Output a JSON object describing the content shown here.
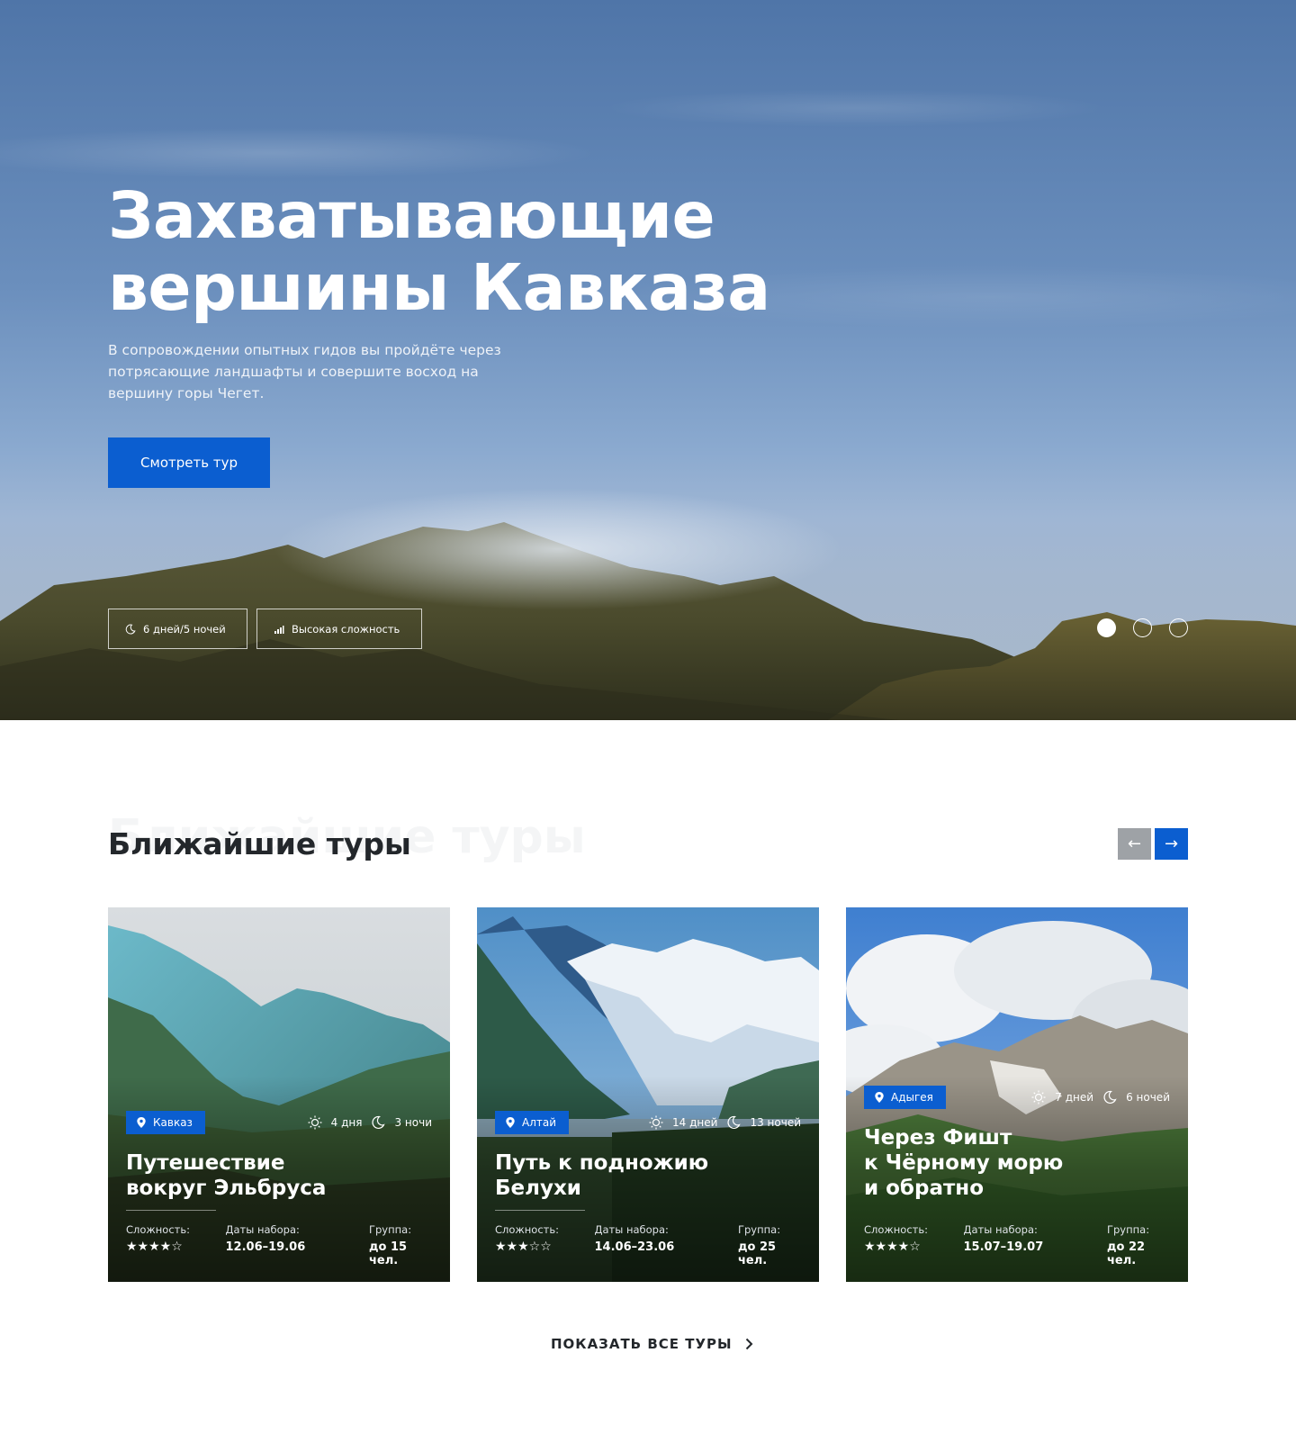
{
  "hero": {
    "title_line1": "Захватывающие",
    "title_line2": "вершины Кавказа",
    "description": "В сопровождении опытных гидов вы пройдёте через потрясающие ландшафты и совершите восход на вершину горы Чегет.",
    "button_label": "Смотреть тур",
    "tag_duration": "6 дней/5 ночей",
    "tag_difficulty": "Высокая сложность",
    "slides": 3,
    "active_slide": 1
  },
  "section": {
    "title": "Ближайшие туры",
    "ghost_title": "Ближайшие туры",
    "prev_label": "←",
    "next_label": "→"
  },
  "labels": {
    "difficulty": "Сложность:",
    "dates": "Даты набора:",
    "group": "Группа:"
  },
  "tours": [
    {
      "region": "Кавказ",
      "days": "4 дня",
      "nights": "3 ночи",
      "title_line1": "Путешествие",
      "title_line2": "вокруг Эльбруса",
      "title_line3": "",
      "difficulty_stars": "★★★★☆",
      "difficulty_rating": 4,
      "dates": "12.06–19.06",
      "group": "до 15 чел."
    },
    {
      "region": "Алтай",
      "days": "14 дней",
      "nights": "13 ночей",
      "title_line1": "Путь к подножию",
      "title_line2": "Белухи",
      "title_line3": "",
      "difficulty_stars": "★★★☆☆",
      "difficulty_rating": 3,
      "dates": "14.06–23.06",
      "group": "до 25 чел."
    },
    {
      "region": "Адыгея",
      "days": "7 дней",
      "nights": "6 ночей",
      "title_line1": "Через Фишт",
      "title_line2": "к Чёрному морю",
      "title_line3": "и обратно",
      "difficulty_stars": "★★★★☆",
      "difficulty_rating": 4,
      "dates": "15.07–19.07",
      "group": "до 22 чел."
    }
  ],
  "show_all_label": "ПОКАЗАТЬ ВСЕ ТУРЫ",
  "colors": {
    "accent": "#0b5ed0",
    "dark_text": "#23272b",
    "muted_button": "#9ea2a6"
  }
}
